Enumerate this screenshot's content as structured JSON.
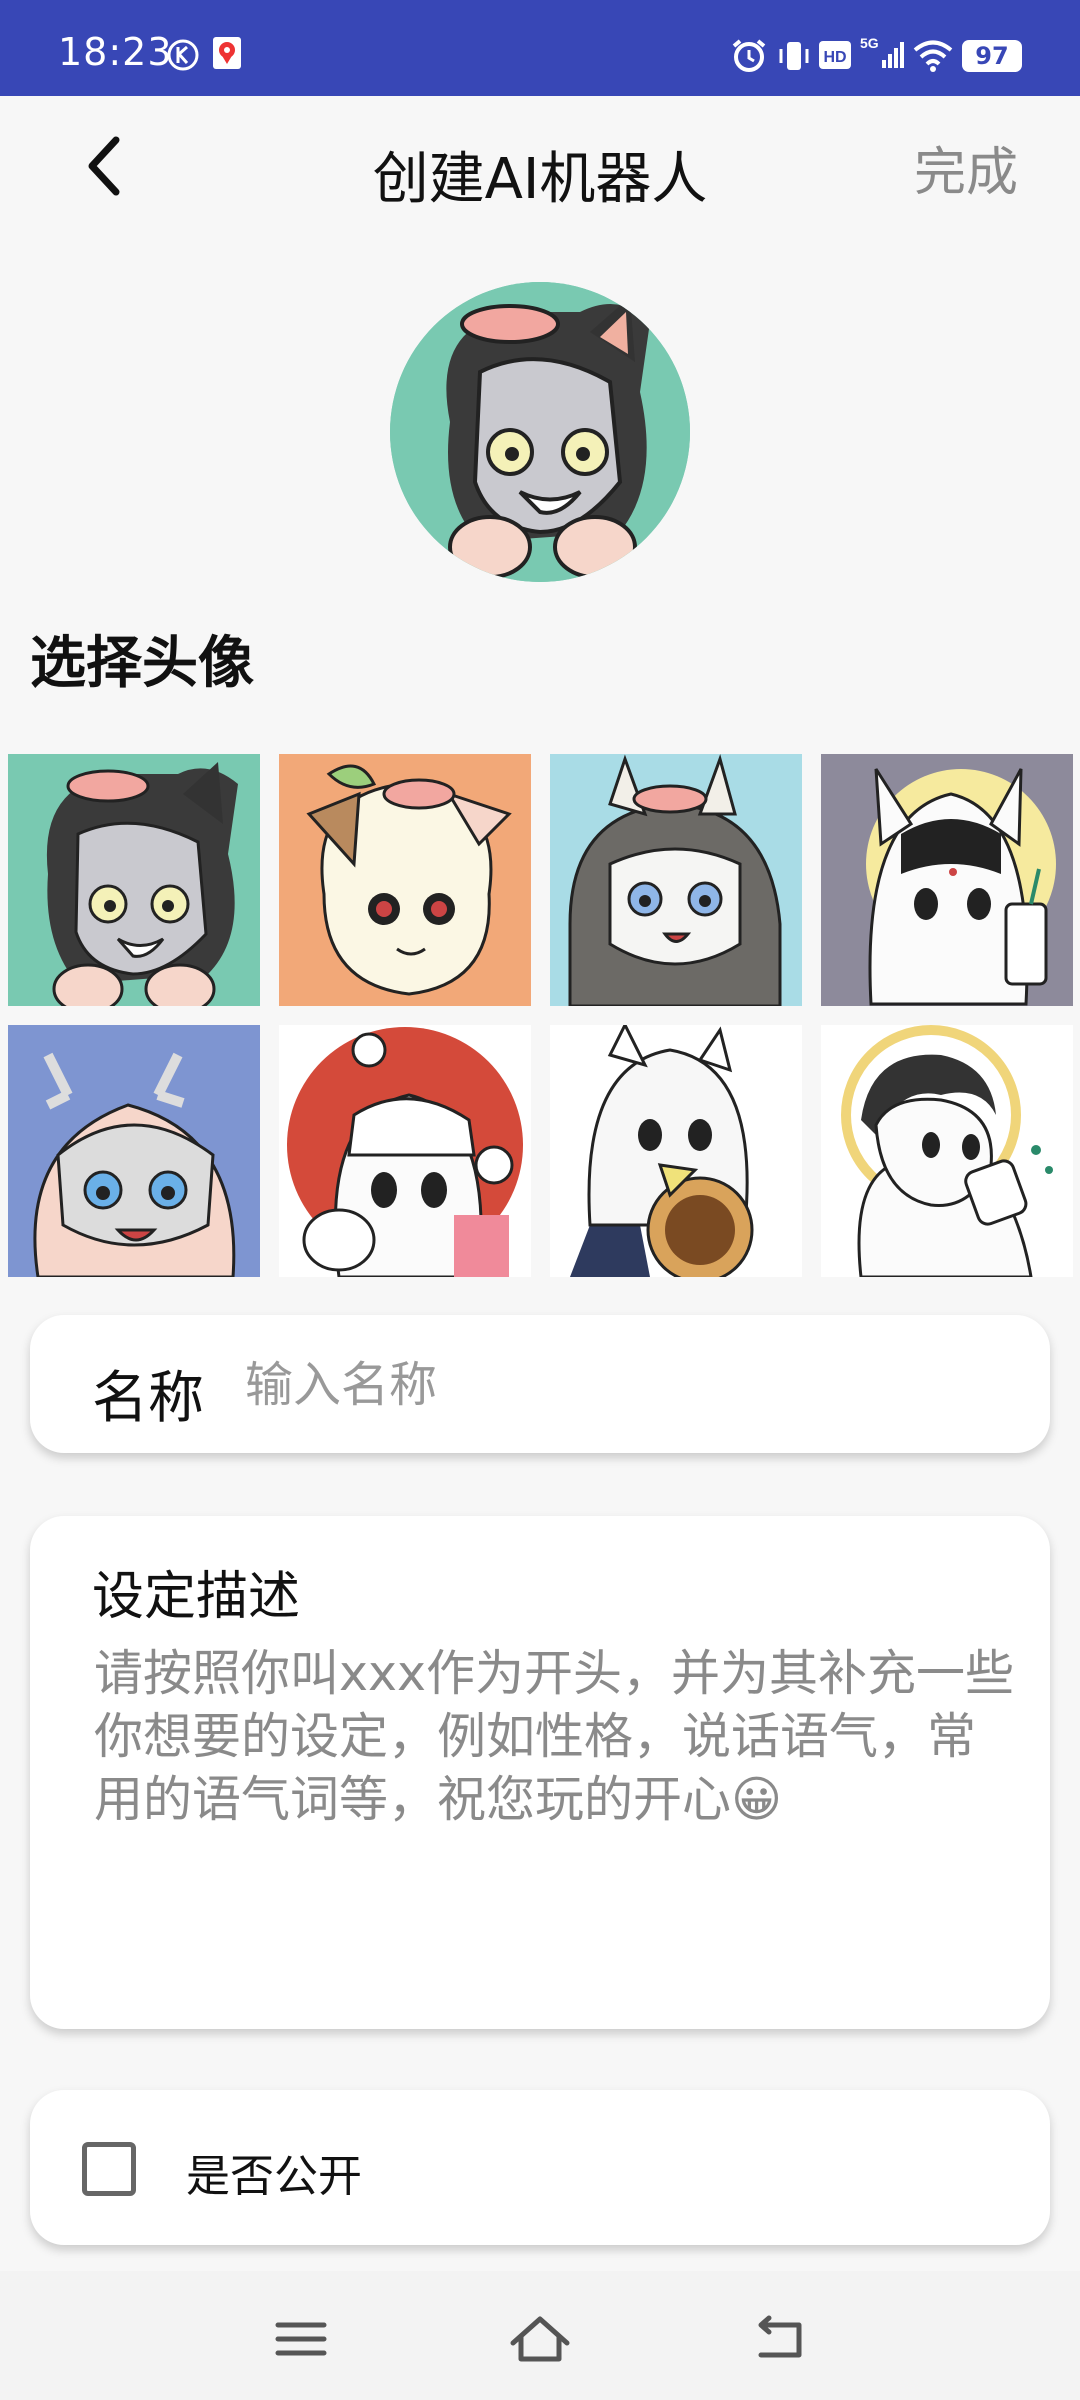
{
  "status_bar": {
    "time": "18:23",
    "battery": "97"
  },
  "nav": {
    "title": "创建AI机器人",
    "done_label": "完成"
  },
  "avatar_section": {
    "title": "选择头像"
  },
  "form": {
    "name_label": "名称",
    "name_placeholder": "输入名称",
    "name_value": "",
    "description_label": "设定描述",
    "description_placeholder": "请按照你叫xxx作为开头，并为其补充一些你想要的设定，例如性格，说话语气，常用的语气词等，祝您玩的开心😀",
    "public_label": "是否公开",
    "public_checked": false
  },
  "avatars": [
    {
      "name": "avatar-grey-dog-hood",
      "bg": "#79c9b1"
    },
    {
      "name": "avatar-cream-sheep-hood",
      "bg": "#f2a878"
    },
    {
      "name": "avatar-horned-hood",
      "bg": "#a9dce6"
    },
    {
      "name": "avatar-white-fox-halo",
      "bg": "#8d8a9b"
    },
    {
      "name": "avatar-deer-blue",
      "bg": "#7e95d1"
    },
    {
      "name": "avatar-white-hair-red-circle",
      "bg": "#ffffff"
    },
    {
      "name": "avatar-eating-girl",
      "bg": "#ffffff"
    },
    {
      "name": "avatar-halo-drinker",
      "bg": "#ffffff"
    }
  ]
}
